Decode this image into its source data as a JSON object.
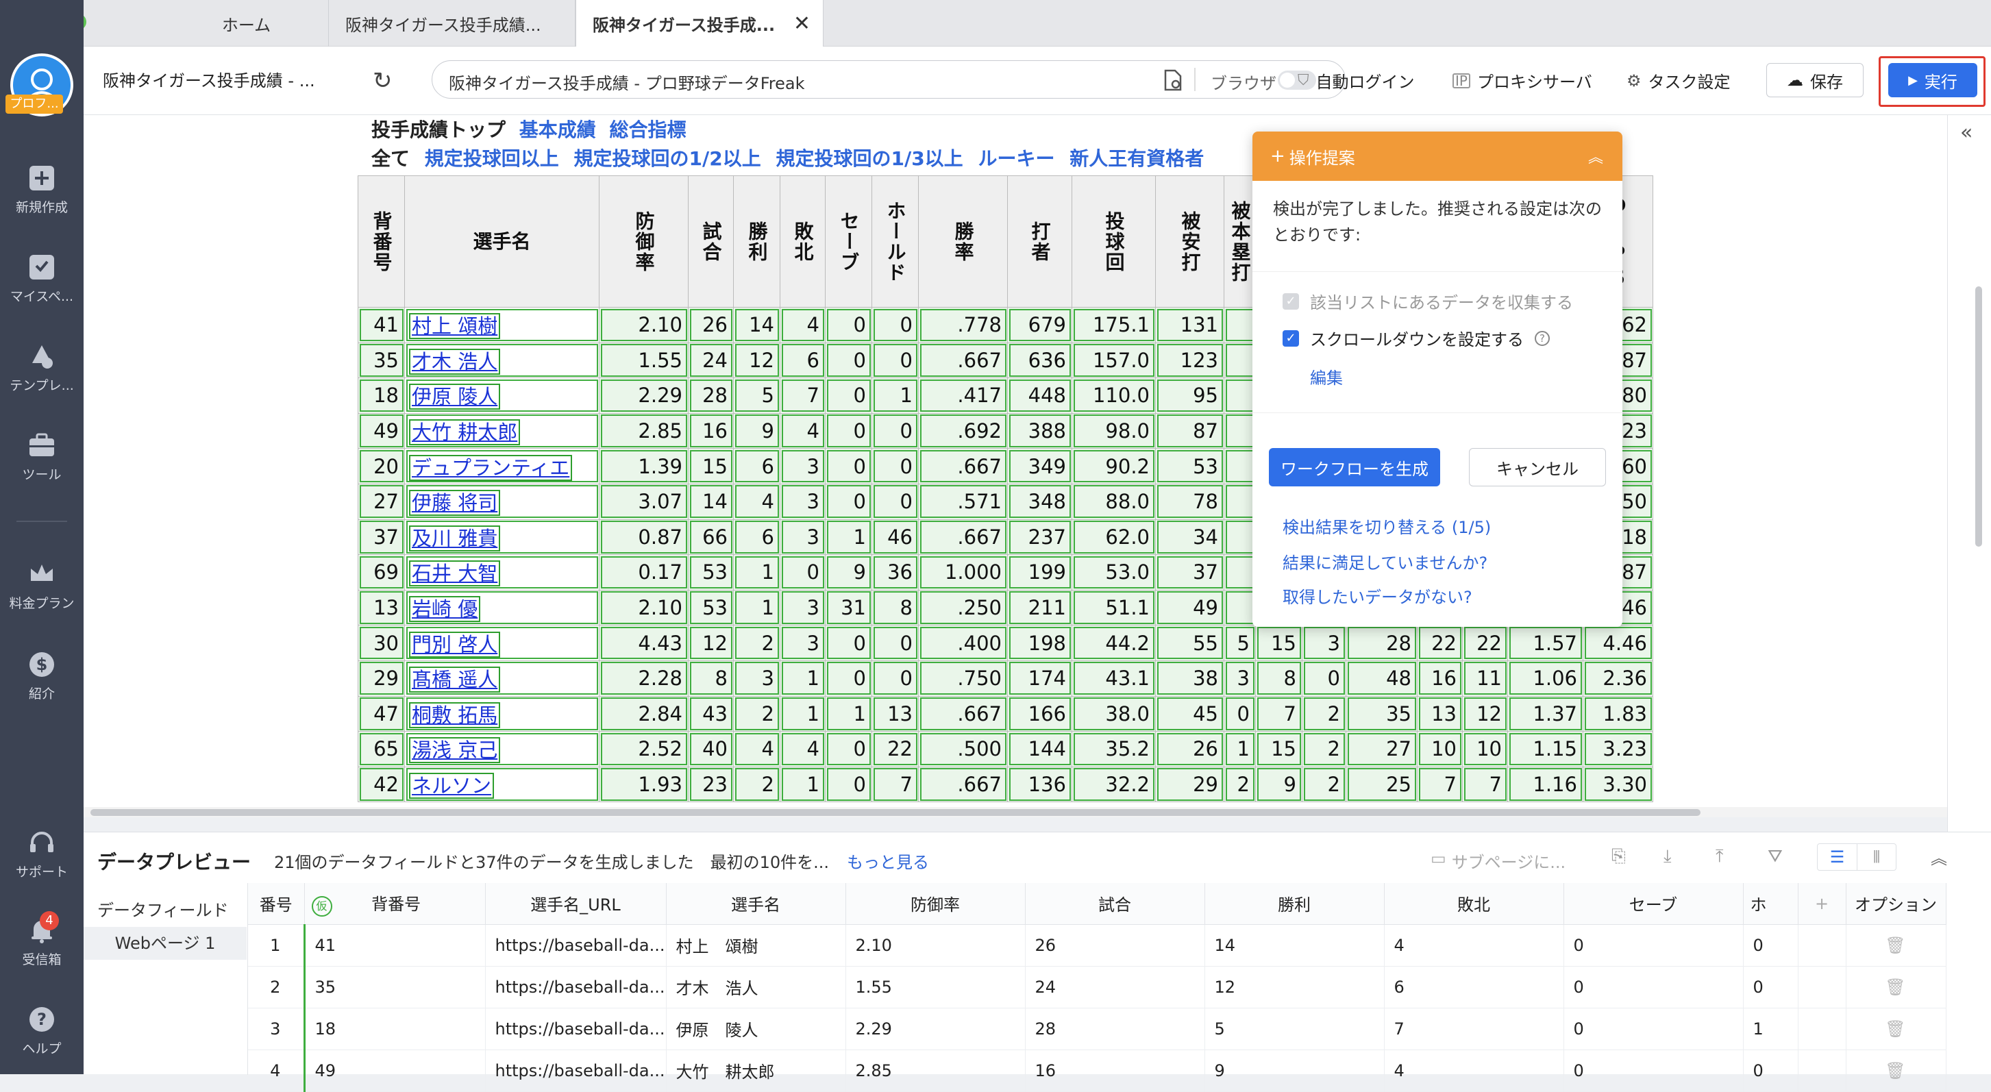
{
  "tabs": [
    {
      "label": "ホーム"
    },
    {
      "label": "阪神タイガース投手成績..."
    },
    {
      "label": "阪神タイガース投手成..."
    }
  ],
  "sidebar": {
    "avatar_badge": "プロフ...",
    "items": [
      {
        "label": "新規作成",
        "icon": "plus-icon"
      },
      {
        "label": "マイスペ...",
        "icon": "bookmark-icon"
      },
      {
        "label": "テンプレ...",
        "icon": "template-icon"
      },
      {
        "label": "ツール",
        "icon": "toolbox-icon"
      },
      {
        "label": "料金プラン",
        "icon": "crown-icon"
      },
      {
        "label": "紹介",
        "icon": "dollar-icon"
      },
      {
        "label": "サポート",
        "icon": "headset-icon"
      },
      {
        "label": "受信箱",
        "icon": "bell-icon",
        "badge": "4"
      },
      {
        "label": "ヘルプ",
        "icon": "help-icon"
      }
    ]
  },
  "toolbar": {
    "page_title": "阪神タイガース投手成績 - ...",
    "url_text": "阪神タイガース投手成績 - プロ野球データFreak",
    "browser_label": "ブラウザ",
    "auto_login": "自動ログイン",
    "proxy": "プロキシサーバ",
    "task_settings": "タスク設定",
    "save": "保存",
    "run": "実行",
    "accent_color": "#2f6fe8"
  },
  "web": {
    "nav1": {
      "label": "投手成績トップ",
      "links": [
        "基本成績",
        "総合指標"
      ]
    },
    "nav2": {
      "label": "全て",
      "links": [
        "規定投球回以上",
        "規定投球回の1/2以上",
        "規定投球回の1/3以上",
        "ルーキー",
        "新人王有資格者"
      ]
    },
    "headers": [
      "背番号",
      "選手名",
      "防御率",
      "試合",
      "勝利",
      "敗北",
      "セーブ",
      "ホールド",
      "勝率",
      "打者",
      "投球回",
      "被安打",
      "被本塁打",
      "",
      "",
      "",
      "",
      "",
      "",
      "DIPS"
    ],
    "rows": [
      [
        "41",
        "村上 頌樹",
        "2.10",
        "26",
        "14",
        "4",
        "0",
        "0",
        ".778",
        "679",
        "175.1",
        "131",
        "",
        "",
        "",
        "",
        "",
        "",
        "",
        "2.62"
      ],
      [
        "35",
        "才木 浩人",
        "1.55",
        "24",
        "12",
        "6",
        "0",
        "0",
        ".667",
        "636",
        "157.0",
        "123",
        "",
        "",
        "",
        "",
        "",
        "",
        "",
        "2.87"
      ],
      [
        "18",
        "伊原 陵人",
        "2.29",
        "28",
        "5",
        "7",
        "0",
        "1",
        ".417",
        "448",
        "110.0",
        "95",
        "",
        "",
        "",
        "",
        "",
        "",
        "",
        "2.80"
      ],
      [
        "49",
        "大竹 耕太郎",
        "2.85",
        "16",
        "9",
        "4",
        "0",
        "0",
        ".692",
        "388",
        "98.0",
        "87",
        "",
        "",
        "",
        "",
        "",
        "",
        "",
        "3.23"
      ],
      [
        "20",
        "デュプランティエ",
        "1.39",
        "15",
        "6",
        "3",
        "0",
        "0",
        ".667",
        "349",
        "90.2",
        "53",
        "",
        "",
        "",
        "",
        "",
        "",
        "",
        "1.60"
      ],
      [
        "27",
        "伊藤 将司",
        "3.07",
        "14",
        "4",
        "3",
        "0",
        "0",
        ".571",
        "348",
        "88.0",
        "78",
        "",
        "",
        "",
        "",
        "",
        "",
        "",
        "3.50"
      ],
      [
        "37",
        "及川 雅貴",
        "0.87",
        "66",
        "6",
        "3",
        "1",
        "46",
        ".667",
        "237",
        "62.0",
        "34",
        "",
        "",
        "",
        "",
        "",
        "",
        "",
        "2.18"
      ],
      [
        "69",
        "石井 大智",
        "0.17",
        "53",
        "1",
        "0",
        "9",
        "36",
        "1.000",
        "199",
        "53.0",
        "37",
        "",
        "",
        "",
        "",
        "",
        "",
        "",
        "1.87"
      ],
      [
        "13",
        "岩崎 優",
        "2.10",
        "53",
        "1",
        "3",
        "31",
        "8",
        ".250",
        "211",
        "51.1",
        "49",
        "",
        "",
        "",
        "",
        "",
        "",
        "",
        "2.46"
      ],
      [
        "30",
        "門別 啓人",
        "4.43",
        "12",
        "2",
        "3",
        "0",
        "0",
        ".400",
        "198",
        "44.2",
        "55",
        "5",
        "15",
        "3",
        "28",
        "22",
        "22",
        "1.57",
        "4.46"
      ],
      [
        "29",
        "髙橋 遥人",
        "2.28",
        "8",
        "3",
        "1",
        "0",
        "0",
        ".750",
        "174",
        "43.1",
        "38",
        "3",
        "8",
        "0",
        "48",
        "16",
        "11",
        "1.06",
        "2.36"
      ],
      [
        "47",
        "桐敷 拓馬",
        "2.84",
        "43",
        "2",
        "1",
        "1",
        "13",
        ".667",
        "166",
        "38.0",
        "45",
        "0",
        "7",
        "2",
        "35",
        "13",
        "12",
        "1.37",
        "1.83"
      ],
      [
        "65",
        "湯浅 京己",
        "2.52",
        "40",
        "4",
        "4",
        "0",
        "22",
        ".500",
        "144",
        "35.2",
        "26",
        "1",
        "15",
        "2",
        "27",
        "10",
        "10",
        "1.15",
        "3.23"
      ],
      [
        "42",
        "ネルソン",
        "1.93",
        "23",
        "2",
        "1",
        "0",
        "7",
        ".667",
        "136",
        "32.2",
        "29",
        "2",
        "9",
        "2",
        "25",
        "7",
        "7",
        "1.16",
        "3.30"
      ]
    ]
  },
  "popup": {
    "title": "操作提案",
    "message": "検出が完了しました。推奨される設定は次のとおりです:",
    "opt1": "該当リストにあるデータを収集する",
    "opt2": "スクロールダウンを設定する",
    "edit": "編集",
    "generate": "ワークフローを生成",
    "cancel": "キャンセル",
    "link1": "検出結果を切り替える (1/5)",
    "link2": "結果に満足していませんか?",
    "link3": "取得したいデータがない?"
  },
  "preview": {
    "title": "データプレビュー",
    "summary": "21個のデータフィールドと37件のデータを生成しました　最初の10件を...",
    "more": "もっと見る",
    "subpage": "サブページに...",
    "field_label": "データフィールド",
    "field_item": "Webページ 1",
    "headers": [
      "番号",
      "仮",
      "背番号",
      "選手名_URL",
      "選手名",
      "防御率",
      "試合",
      "勝利",
      "敗北",
      "セーブ",
      "ホ",
      "+",
      "オプション"
    ],
    "rows": [
      [
        "1",
        "41",
        "https://baseball-da...",
        "村上　頌樹",
        "2.10",
        "26",
        "14",
        "4",
        "0",
        "0"
      ],
      [
        "2",
        "35",
        "https://baseball-da...",
        "才木　浩人",
        "1.55",
        "24",
        "12",
        "6",
        "0",
        "0"
      ],
      [
        "3",
        "18",
        "https://baseball-da...",
        "伊原　陵人",
        "2.29",
        "28",
        "5",
        "7",
        "0",
        "1"
      ],
      [
        "4",
        "49",
        "https://baseball-da...",
        "大竹　耕太郎",
        "2.85",
        "16",
        "9",
        "4",
        "0",
        "0"
      ]
    ]
  }
}
